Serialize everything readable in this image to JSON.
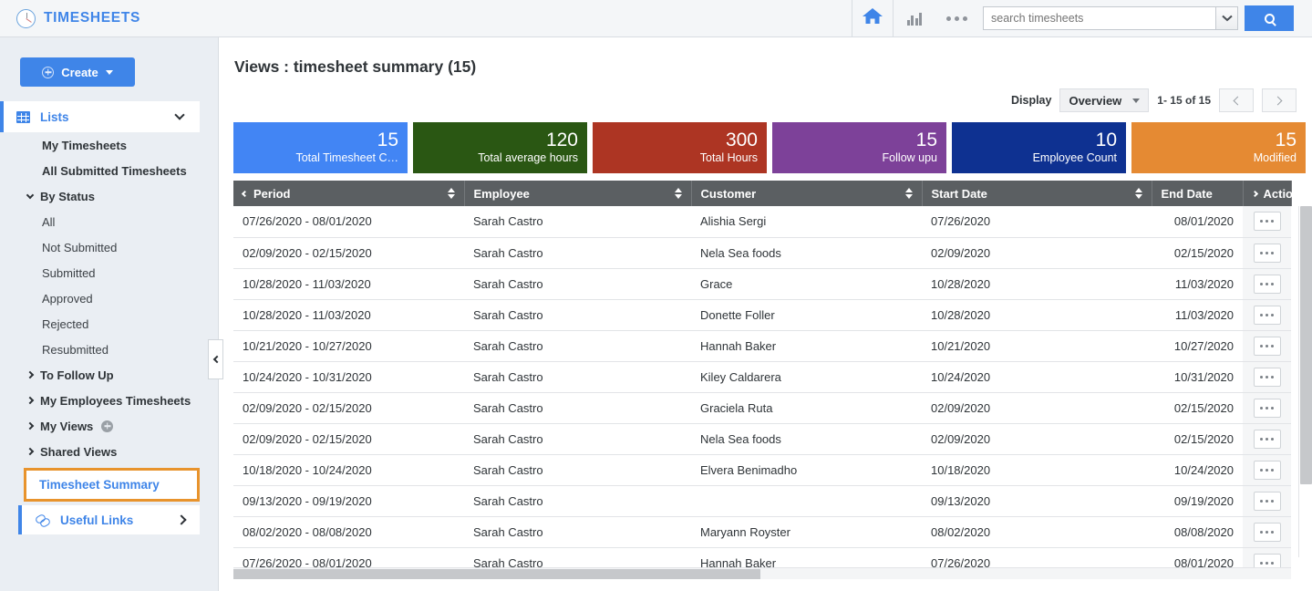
{
  "app": {
    "brand_title": "TIMESHEETS",
    "clock_icon": "clock-icon"
  },
  "topbar": {
    "home_icon": "home-icon",
    "chart_icon": "bar-chart-icon",
    "more_icon": "ellipsis-icon",
    "search_placeholder": "search timesheets",
    "search_value": "",
    "search_dropdown_icon": "chevron-down-icon",
    "search_button_icon": "search-icon"
  },
  "sidebar": {
    "create_label": "Create",
    "lists_label": "Lists",
    "items": [
      {
        "label": "My Timesheets",
        "type": "item"
      },
      {
        "label": "All Submitted Timesheets",
        "type": "item"
      },
      {
        "label": "By Status",
        "type": "group-open"
      },
      {
        "label": "All",
        "type": "sub"
      },
      {
        "label": "Not Submitted",
        "type": "sub"
      },
      {
        "label": "Submitted",
        "type": "sub"
      },
      {
        "label": "Approved",
        "type": "sub"
      },
      {
        "label": "Rejected",
        "type": "sub"
      },
      {
        "label": "Resubmitted",
        "type": "sub"
      },
      {
        "label": "To Follow Up",
        "type": "group"
      },
      {
        "label": "My Employees Timesheets",
        "type": "group"
      },
      {
        "label": "My Views",
        "type": "group-add"
      },
      {
        "label": "Shared Views",
        "type": "group"
      }
    ],
    "selected_view": "Timesheet Summary",
    "useful_links": "Useful Links",
    "collapse_icon": "chevron-left-icon"
  },
  "main": {
    "page_title": "Views : timesheet summary (15)",
    "display_label": "Display",
    "display_value": "Overview",
    "range_text": "1- 15 of 15",
    "prev_icon": "chevron-left-icon",
    "next_icon": "chevron-right-icon"
  },
  "tiles": [
    {
      "value": "15",
      "label": "Total Timesheet C…",
      "color": "#4285f4"
    },
    {
      "value": "120",
      "label": "Total average hours",
      "color": "#2a5713"
    },
    {
      "value": "300",
      "label": "Total Hours",
      "color": "#ad3523"
    },
    {
      "value": "15",
      "label": "Follow upu",
      "color": "#7d4199"
    },
    {
      "value": "10",
      "label": "Employee Count",
      "color": "#0e3191"
    },
    {
      "value": "15",
      "label": "Modified",
      "color": "#e58a33"
    }
  ],
  "table": {
    "columns": [
      {
        "label": "Period",
        "sortable": true
      },
      {
        "label": "Employee",
        "sortable": true
      },
      {
        "label": "Customer",
        "sortable": true
      },
      {
        "label": "Start Date",
        "sortable": true
      },
      {
        "label": "End Date",
        "sortable": false
      },
      {
        "label": "Actions",
        "sortable": false
      }
    ],
    "rows": [
      {
        "period": "07/26/2020 - 08/01/2020",
        "employee": "Sarah Castro",
        "customer": "Alishia Sergi",
        "start": "07/26/2020",
        "end": "08/01/2020"
      },
      {
        "period": "02/09/2020 - 02/15/2020",
        "employee": "Sarah Castro",
        "customer": "Nela Sea foods",
        "start": "02/09/2020",
        "end": "02/15/2020"
      },
      {
        "period": "10/28/2020 - 11/03/2020",
        "employee": "Sarah Castro",
        "customer": "Grace",
        "start": "10/28/2020",
        "end": "11/03/2020"
      },
      {
        "period": "10/28/2020 - 11/03/2020",
        "employee": "Sarah Castro",
        "customer": "Donette Foller",
        "start": "10/28/2020",
        "end": "11/03/2020"
      },
      {
        "period": "10/21/2020 - 10/27/2020",
        "employee": "Sarah Castro",
        "customer": "Hannah Baker",
        "start": "10/21/2020",
        "end": "10/27/2020"
      },
      {
        "period": "10/24/2020 - 10/31/2020",
        "employee": "Sarah Castro",
        "customer": "Kiley Caldarera",
        "start": "10/24/2020",
        "end": "10/31/2020"
      },
      {
        "period": "02/09/2020 - 02/15/2020",
        "employee": "Sarah Castro",
        "customer": "Graciela Ruta",
        "start": "02/09/2020",
        "end": "02/15/2020"
      },
      {
        "period": "02/09/2020 - 02/15/2020",
        "employee": "Sarah Castro",
        "customer": "Nela Sea foods",
        "start": "02/09/2020",
        "end": "02/15/2020"
      },
      {
        "period": "10/18/2020 - 10/24/2020",
        "employee": "Sarah Castro",
        "customer": "Elvera Benimadho",
        "start": "10/18/2020",
        "end": "10/24/2020"
      },
      {
        "period": "09/13/2020 - 09/19/2020",
        "employee": "Sarah Castro",
        "customer": "",
        "start": "09/13/2020",
        "end": "09/19/2020"
      },
      {
        "period": "08/02/2020 - 08/08/2020",
        "employee": "Sarah Castro",
        "customer": "Maryann Royster",
        "start": "08/02/2020",
        "end": "08/08/2020"
      },
      {
        "period": "07/26/2020 - 08/01/2020",
        "employee": "Sarah Castro",
        "customer": "Hannah Baker",
        "start": "07/26/2020",
        "end": "08/01/2020"
      }
    ],
    "row_action_icon": "ellipsis-icon"
  }
}
